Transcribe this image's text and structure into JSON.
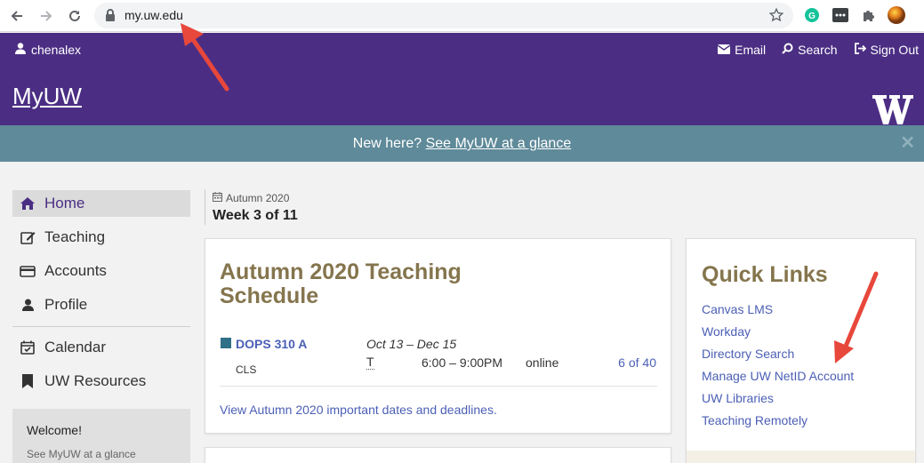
{
  "browser": {
    "url": "my.uw.edu",
    "icons": [
      "back-arrow-icon",
      "forward-arrow-icon",
      "reload-icon",
      "lock-icon",
      "bookmark-star-icon",
      "grammarly-extension-icon",
      "extension-icon",
      "puzzle-extensions-icon",
      "profile-avatar-icon"
    ]
  },
  "topbar": {
    "username": "chenalex",
    "email_label": "Email",
    "search_label": "Search",
    "signout_label": "Sign Out"
  },
  "header": {
    "brand": "MyUW",
    "logo": "W"
  },
  "banner": {
    "prefix": "New here? ",
    "link": "See MyUW at a glance",
    "close": "✕"
  },
  "sidebar": {
    "items": [
      {
        "label": "Home",
        "icon": "home-icon",
        "active": true
      },
      {
        "label": "Teaching",
        "icon": "edit-icon"
      },
      {
        "label": "Accounts",
        "icon": "credit-card-icon"
      },
      {
        "label": "Profile",
        "icon": "user-icon"
      },
      {
        "label": "Calendar",
        "icon": "calendar-check-icon"
      },
      {
        "label": "UW Resources",
        "icon": "bookmark-icon"
      }
    ],
    "welcome": {
      "title": "Welcome!",
      "subtitle": "See MyUW at a glance"
    }
  },
  "term": {
    "quarter": "Autumn 2020",
    "week": "Week 3 of 11"
  },
  "schedule": {
    "title": "Autumn 2020 Teaching Schedule",
    "course": {
      "code": "DOPS 310 A",
      "type": "CLS",
      "dates": "Oct 13 – Dec 15",
      "day": "T",
      "time": "6:00 – 9:00PM",
      "location": "online",
      "enrollment": "6 of 40"
    },
    "dates_link": "View Autumn 2020 important dates and deadlines."
  },
  "quick_links": {
    "title": "Quick Links",
    "links": [
      "Canvas LMS",
      "Workday",
      "Directory Search",
      "Manage UW NetID Account",
      "UW Libraries",
      "Teaching Remotely"
    ]
  },
  "colors": {
    "uw_purple": "#4b2e83",
    "gold": "#85754d",
    "banner": "#5f8a99",
    "link": "#4b5fb5",
    "annotation_arrow": "#e8473c"
  }
}
